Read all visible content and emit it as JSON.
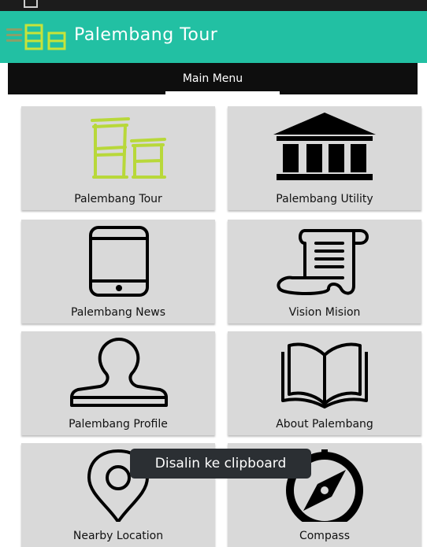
{
  "app": {
    "title": "Palembang Tour"
  },
  "tabs": [
    {
      "label": "Main Menu",
      "selected": true
    }
  ],
  "menu": [
    {
      "label": "Palembang Tour",
      "icon": "buildings-icon"
    },
    {
      "label": "Palembang Utility",
      "icon": "bank-icon"
    },
    {
      "label": "Palembang News",
      "icon": "smartphone-icon"
    },
    {
      "label": "Vision Mision",
      "icon": "scroll-icon"
    },
    {
      "label": "Palembang Profile",
      "icon": "stamp-icon"
    },
    {
      "label": "About Palembang",
      "icon": "open-book-icon"
    },
    {
      "label": "Nearby Location",
      "icon": "map-pin-icon"
    },
    {
      "label": "Compass",
      "icon": "compass-icon"
    }
  ],
  "toast": {
    "text": "Disalin ke clipboard"
  },
  "colors": {
    "appbar": "#22c0a3",
    "tabbar": "#0e0e0e",
    "tile": "#d9d9d9",
    "logo": "#b8d83a"
  }
}
